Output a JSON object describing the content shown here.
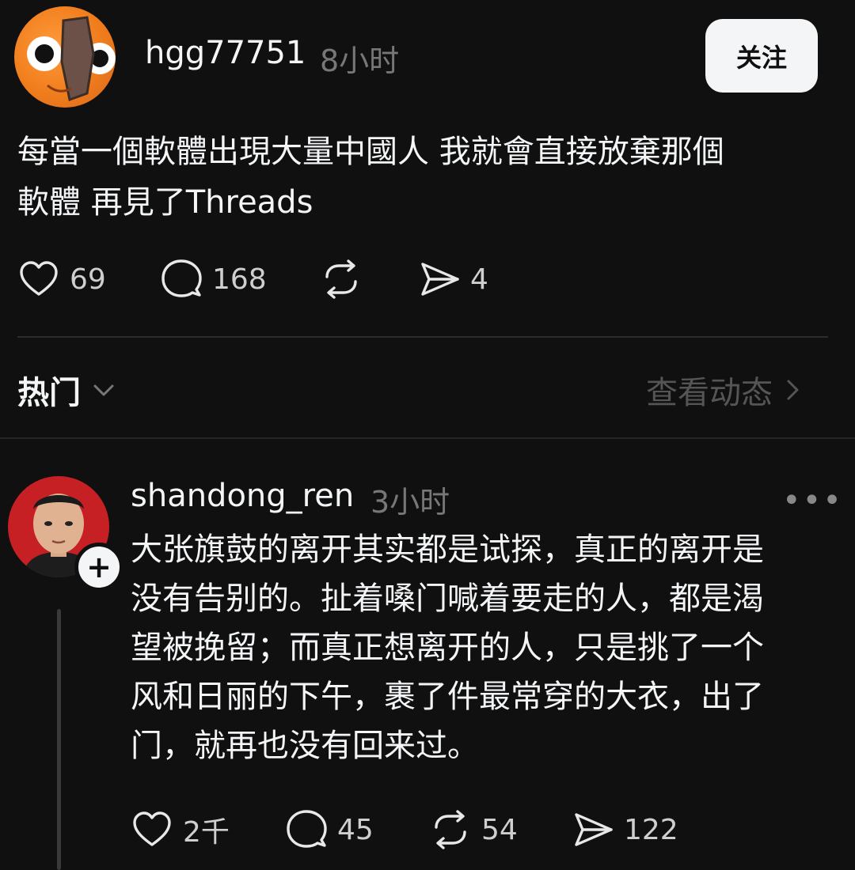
{
  "post": {
    "username": "hgg77751",
    "time": "8小时",
    "follow_label": "关注",
    "text_line1": "每當一個軟體出現大量中國人 我就會直接放棄那個",
    "text_line2": "軟體 再見了Threads",
    "likes": "69",
    "comments": "168",
    "shares": "4"
  },
  "sort": {
    "label": "热门",
    "activity_label": "查看动态"
  },
  "reply": {
    "username": "shandong_ren",
    "time": "3小时",
    "lines": [
      "大张旗鼓的离开其实都是试探，真正的离开是",
      "没有告别的。扯着嗓门喊着要走的人，都是渴",
      "望被挽留；而真正想离开的人，只是挑了一个",
      "风和日丽的下午，裹了件最常穿的大衣，出了",
      "门，就再也没有回来过。"
    ],
    "likes": "2千",
    "comments": "45",
    "reposts": "54",
    "shares": "122"
  }
}
